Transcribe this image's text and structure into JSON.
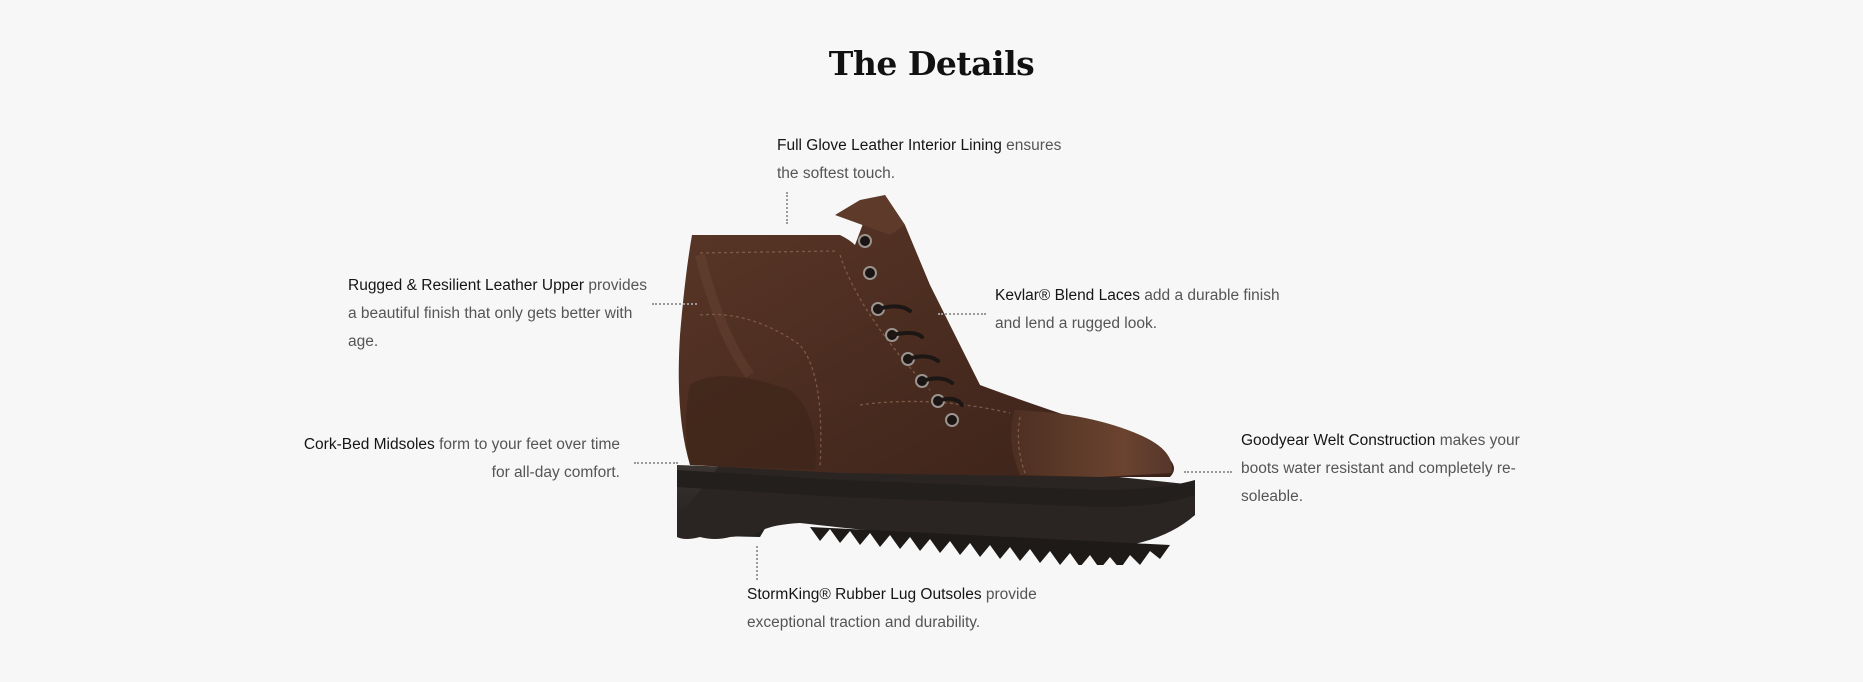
{
  "section": {
    "title": "The Details"
  },
  "features": {
    "lining": {
      "name": "Full Glove Leather Interior Lining",
      "description": " ensures the softest touch."
    },
    "upper": {
      "name": "Rugged & Resilient Leather Upper",
      "description": " provides a beautiful finish that only gets better with age."
    },
    "laces": {
      "name": "Kevlar® Blend Laces",
      "description": " add a durable finish and lend a rugged look."
    },
    "midsoles": {
      "name": "Cork-Bed Midsoles",
      "description": " form to your feet over time for all-day comfort."
    },
    "welt": {
      "name": "Goodyear Welt Construction",
      "description": " makes your boots water resistant and completely re-soleable."
    },
    "outsoles": {
      "name": "StormKing® Rubber Lug Outsoles",
      "description": " provide exceptional traction and durability."
    }
  },
  "colors": {
    "background": "#f7f7f7",
    "leather": "#4a2c20",
    "sole": "#2b2725",
    "leader_line": "#9a9a9a"
  }
}
